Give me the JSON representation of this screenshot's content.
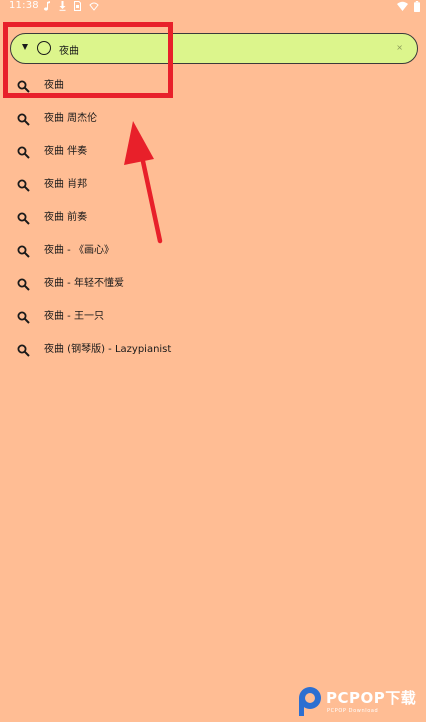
{
  "status_bar": {
    "time": "11:38",
    "icons_left": [
      "music-note-icon",
      "download-icon",
      "sim-icon",
      "vpn-icon"
    ],
    "icons_right": [
      "wifi-icon",
      "battery-icon"
    ]
  },
  "search": {
    "value": "夜曲",
    "clear_glyph": "×"
  },
  "suggestions": [
    {
      "label": "夜曲"
    },
    {
      "label": "夜曲 周杰伦"
    },
    {
      "label": "夜曲 伴奏"
    },
    {
      "label": "夜曲 肖邦"
    },
    {
      "label": "夜曲 前奏"
    },
    {
      "label": "夜曲 - 《画心》"
    },
    {
      "label": "夜曲 - 年轻不懂爱"
    },
    {
      "label": "夜曲 - 王一只"
    },
    {
      "label": "夜曲 (钢琴版) - Lazypianist"
    }
  ],
  "annotations": {
    "highlight_color": "#e8202a"
  },
  "watermark": {
    "text": "PCPOP下载",
    "sub": "PCPOP Download"
  },
  "colors": {
    "background": "#ffbd94",
    "search_bar": "#dcf58c",
    "text": "#1a1a1a"
  }
}
